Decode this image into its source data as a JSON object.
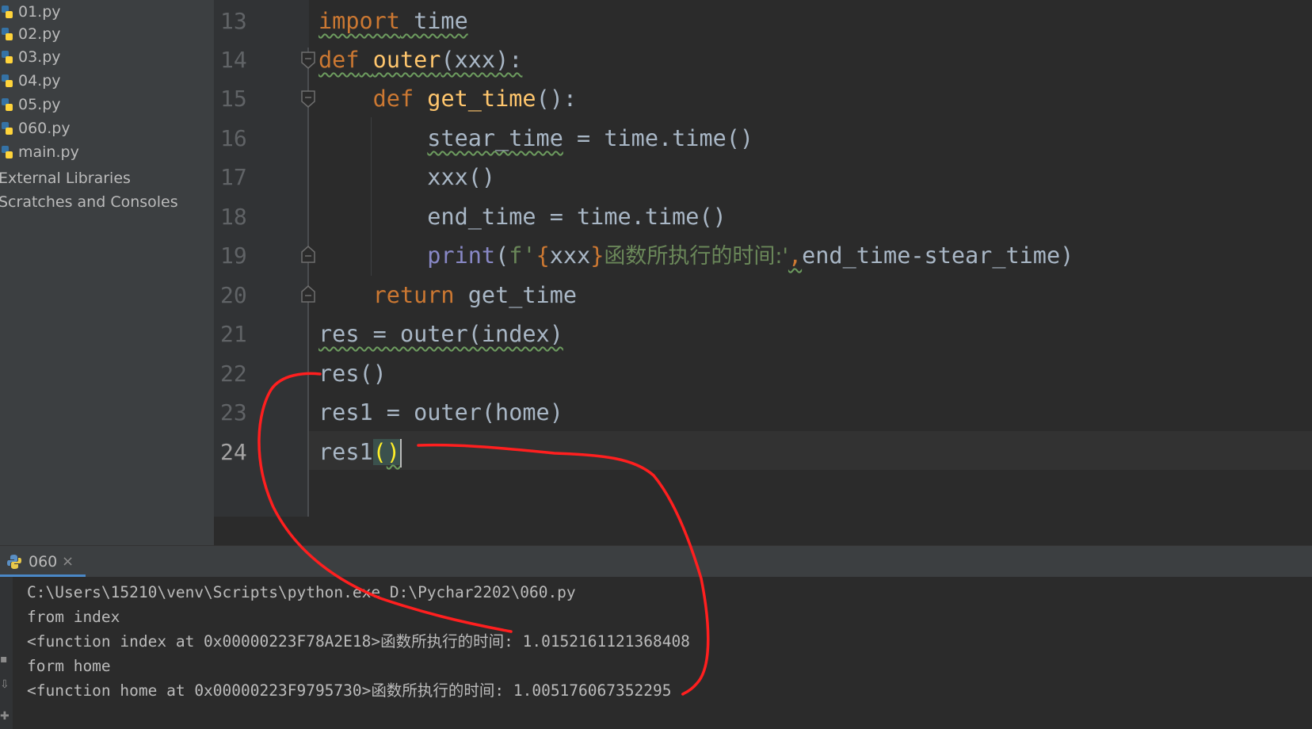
{
  "project_tree": {
    "items": [
      {
        "label": "01.py",
        "icon": "python-file-icon"
      },
      {
        "label": "02.py",
        "icon": "python-file-icon"
      },
      {
        "label": "03.py",
        "icon": "python-file-icon"
      },
      {
        "label": "04.py",
        "icon": "python-file-icon"
      },
      {
        "label": "05.py",
        "icon": "python-file-icon"
      },
      {
        "label": "060.py",
        "icon": "python-file-icon"
      },
      {
        "label": "main.py",
        "icon": "python-file-icon"
      },
      {
        "label": "External Libraries",
        "icon": ""
      },
      {
        "label": "Scratches and Consoles",
        "icon": ""
      }
    ]
  },
  "editor": {
    "line_numbers": [
      "13",
      "14",
      "15",
      "16",
      "17",
      "18",
      "19",
      "20",
      "21",
      "22",
      "23",
      "24"
    ],
    "active_line": "24",
    "code": {
      "l13": {
        "kw": "import",
        "rest": " time"
      },
      "l14": {
        "kw": "def",
        "name": "outer",
        "rest": "(xxx):"
      },
      "l15": {
        "kw": "def",
        "name": "get_time",
        "rest": "():"
      },
      "l16": {
        "var": "stear_time",
        "rest": " = time.time()"
      },
      "l17": {
        "text": "xxx()"
      },
      "l18": {
        "text": "end_time = time.time()"
      },
      "l19": {
        "builtin": "print",
        "open": "(",
        "fprefix": "f'",
        "brace_open": "{",
        "expr": "xxx",
        "brace_close": "}",
        "str": "函数所执行的时间:'",
        "comma": ",",
        "rest": "end_time-stear_time)"
      },
      "l20": {
        "kw": "return",
        "rest": " get_time"
      },
      "l21": {
        "text": "res = outer(index)"
      },
      "l22": {
        "text": "res()"
      },
      "l23": {
        "text": "res1 = outer(home)"
      },
      "l24": {
        "prefix": "res1",
        "paren_open": "(",
        "paren_close": ")"
      }
    }
  },
  "run_panel": {
    "tab_label": "060",
    "close_glyph": "×",
    "console_lines": [
      "C:\\Users\\15210\\venv\\Scripts\\python.exe D:\\Pychar2202\\060.py",
      "from index",
      "<function index at 0x00000223F78A2E18>函数所执行的时间: 1.0152161121368408",
      "form home",
      "<function home at 0x00000223F9795730>函数所执行的时间: 1.005176067352295"
    ]
  },
  "colors": {
    "keyword": "#cc7832",
    "function_name": "#ffc66d",
    "builtin": "#8888c6",
    "string": "#6a8759",
    "default_text": "#a9b7c6",
    "annotation_ink": "#ff1f1f",
    "tab_accent": "#4a88c7"
  }
}
